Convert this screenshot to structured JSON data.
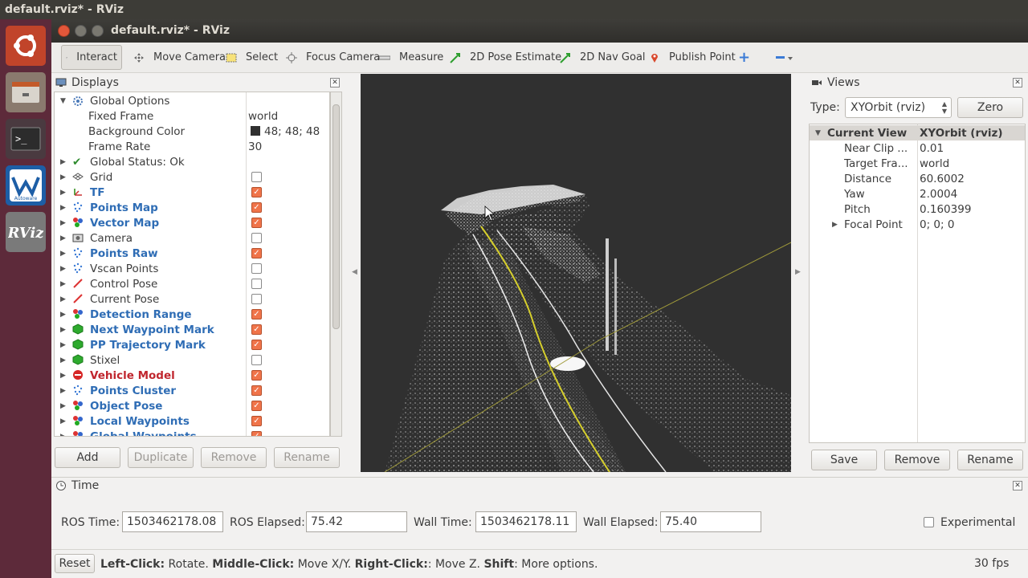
{
  "os_title": "default.rviz* - RViz",
  "window_title": "default.rviz* - RViz",
  "toolbar": {
    "interact": "Interact",
    "move_camera": "Move Camera",
    "select": "Select",
    "focus_camera": "Focus Camera",
    "measure": "Measure",
    "pose_estimate": "2D Pose Estimate",
    "nav_goal": "2D Nav Goal",
    "publish_point": "Publish Point"
  },
  "displays": {
    "title": "Displays",
    "global_options": {
      "label": "Global Options",
      "fixed_frame_label": "Fixed Frame",
      "fixed_frame": "world",
      "bg_label": "Background Color",
      "bg_value": "48; 48; 48",
      "rate_label": "Frame Rate",
      "rate_value": "30"
    },
    "status": "Global Status: Ok",
    "items": [
      {
        "label": "Grid",
        "checked": false,
        "style": "normal",
        "icon": "grid-icon"
      },
      {
        "label": "TF",
        "checked": true,
        "style": "blue",
        "icon": "tf-icon"
      },
      {
        "label": "Points Map",
        "checked": true,
        "style": "blue",
        "icon": "points-icon"
      },
      {
        "label": "Vector Map",
        "checked": true,
        "style": "blue",
        "icon": "marker-array-icon"
      },
      {
        "label": "Camera",
        "checked": false,
        "style": "normal",
        "icon": "camera-icon"
      },
      {
        "label": "Points Raw",
        "checked": true,
        "style": "blue",
        "icon": "points-icon"
      },
      {
        "label": "Vscan Points",
        "checked": false,
        "style": "normal",
        "icon": "points-icon"
      },
      {
        "label": "Control Pose",
        "checked": false,
        "style": "normal",
        "icon": "pose-icon"
      },
      {
        "label": "Current Pose",
        "checked": false,
        "style": "normal",
        "icon": "pose-icon"
      },
      {
        "label": "Detection Range",
        "checked": true,
        "style": "blue",
        "icon": "marker-array-icon"
      },
      {
        "label": "Next Waypoint Mark",
        "checked": true,
        "style": "blue",
        "icon": "marker-icon"
      },
      {
        "label": "PP Trajectory Mark",
        "checked": true,
        "style": "blue",
        "icon": "marker-icon"
      },
      {
        "label": "Stixel",
        "checked": false,
        "style": "normal",
        "icon": "marker-icon"
      },
      {
        "label": "Vehicle Model",
        "checked": true,
        "style": "red",
        "icon": "error-icon"
      },
      {
        "label": "Points Cluster",
        "checked": true,
        "style": "blue",
        "icon": "points-icon"
      },
      {
        "label": "Object Pose",
        "checked": true,
        "style": "blue",
        "icon": "marker-array-icon"
      },
      {
        "label": "Local Waypoints",
        "checked": true,
        "style": "blue",
        "icon": "marker-array-icon"
      },
      {
        "label": "Global Waypoints",
        "checked": true,
        "style": "blue",
        "icon": "marker-array-icon"
      }
    ],
    "buttons": {
      "add": "Add",
      "duplicate": "Duplicate",
      "remove": "Remove",
      "rename": "Rename"
    }
  },
  "views": {
    "title": "Views",
    "type_label": "Type:",
    "type_value": "XYOrbit (rviz)",
    "zero": "Zero",
    "current_view": "Current View",
    "current_type": "XYOrbit (rviz)",
    "props": [
      {
        "label": "Near Clip ...",
        "value": "0.01"
      },
      {
        "label": "Target Fra...",
        "value": "world"
      },
      {
        "label": "Distance",
        "value": "60.6002"
      },
      {
        "label": "Yaw",
        "value": "2.0004"
      },
      {
        "label": "Pitch",
        "value": "0.160399"
      },
      {
        "label": "Focal Point",
        "value": "0; 0; 0"
      }
    ],
    "buttons": {
      "save": "Save",
      "remove": "Remove",
      "rename": "Rename"
    }
  },
  "time": {
    "title": "Time",
    "ros_time_label": "ROS Time:",
    "ros_time": "1503462178.08",
    "ros_elapsed_label": "ROS Elapsed:",
    "ros_elapsed": "75.42",
    "wall_time_label": "Wall Time:",
    "wall_time": "1503462178.11",
    "wall_elapsed_label": "Wall Elapsed:",
    "wall_elapsed": "75.40",
    "experimental": "Experimental"
  },
  "status_bar": {
    "reset": "Reset",
    "left_click": "Left-Click:",
    "left_desc": "Rotate.",
    "middle_click": "Middle-Click:",
    "middle_desc": "Move X/Y.",
    "right_click": "Right-Click:",
    "right_desc": ": Move Z.",
    "shift": "Shift",
    "shift_desc": ": More options.",
    "fps": "30 fps"
  },
  "launcher_items": [
    "ubuntu-dash-icon",
    "files-icon",
    "terminal-icon",
    "autoware-icon",
    "rviz-icon"
  ],
  "launcher_labels": {
    "autoware": "Autoware",
    "rviz": "RViz"
  }
}
